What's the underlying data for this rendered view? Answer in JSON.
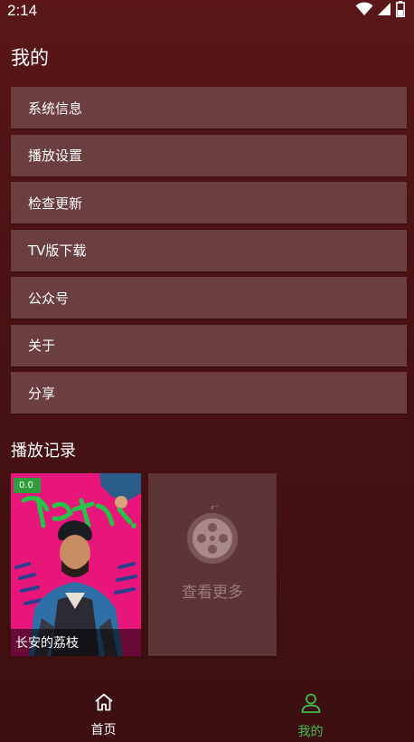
{
  "status_bar": {
    "time": "2:14",
    "icons": [
      "wifi-icon",
      "signal-icon",
      "battery-icon"
    ]
  },
  "page": {
    "title": "我的"
  },
  "menu": {
    "items": [
      {
        "label": "系统信息"
      },
      {
        "label": "播放设置"
      },
      {
        "label": "检查更新"
      },
      {
        "label": "TV版下载"
      },
      {
        "label": "公众号"
      },
      {
        "label": "关于"
      },
      {
        "label": "分享"
      }
    ]
  },
  "history": {
    "title": "播放记录",
    "items": [
      {
        "title": "长安的荔枝",
        "score": "0.0",
        "poster_title": "長安的荔枝"
      }
    ],
    "more_label": "查看更多"
  },
  "bottom_nav": {
    "items": [
      {
        "label": "首页",
        "icon": "home-icon",
        "active": false
      },
      {
        "label": "我的",
        "icon": "person-icon",
        "active": true
      }
    ]
  },
  "colors": {
    "background": "#4a1213",
    "menu_item": "#6b3e40",
    "accent": "#3fbf4a",
    "badge": "#2e9e3a"
  }
}
